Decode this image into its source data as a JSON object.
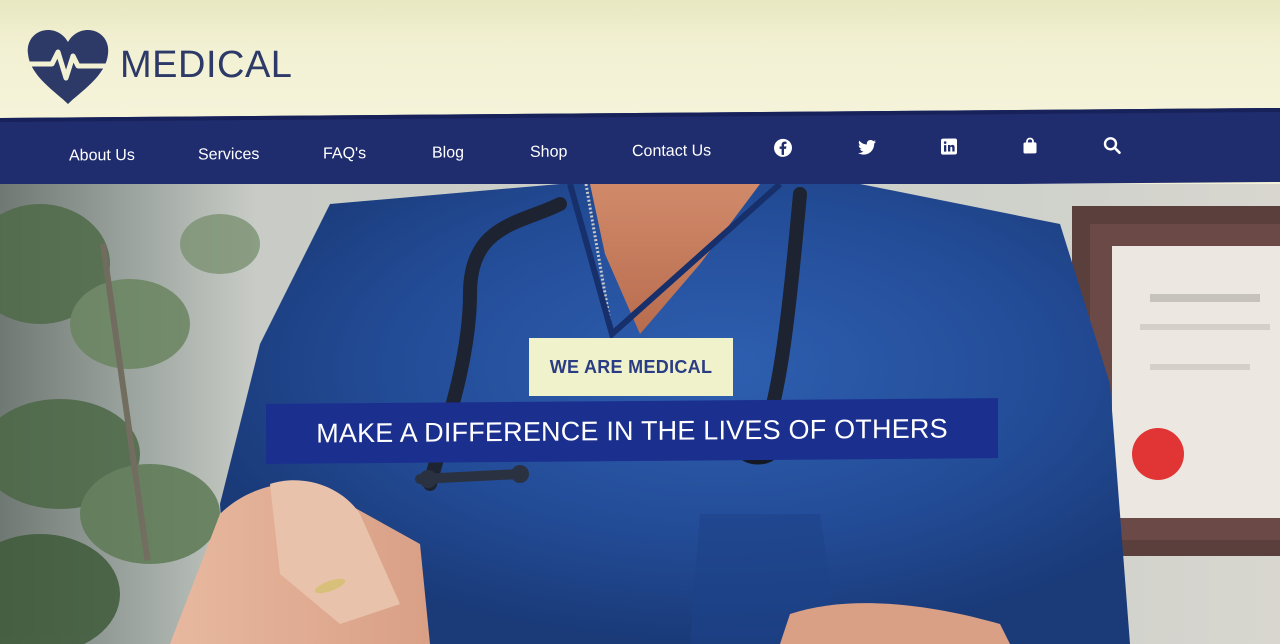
{
  "brand": {
    "name": "MEDICAL",
    "logo_icon": "heart-pulse-icon",
    "color": "#2d3a68"
  },
  "nav": {
    "items": [
      {
        "label": "About Us"
      },
      {
        "label": "Services"
      },
      {
        "label": "FAQ's"
      },
      {
        "label": "Blog"
      },
      {
        "label": "Shop"
      },
      {
        "label": "Contact Us"
      }
    ],
    "icons": [
      "facebook-icon",
      "twitter-icon",
      "linkedin-icon",
      "shopping-bag-icon",
      "search-icon"
    ],
    "background": "#1f2c6e"
  },
  "hero": {
    "tagline": "WE ARE MEDICAL",
    "headline": "MAKE A DIFFERENCE IN THE LIVES OF OTHERS",
    "tagline_bg": "#f0f2cc",
    "headline_bg": "#1b2f8f"
  }
}
